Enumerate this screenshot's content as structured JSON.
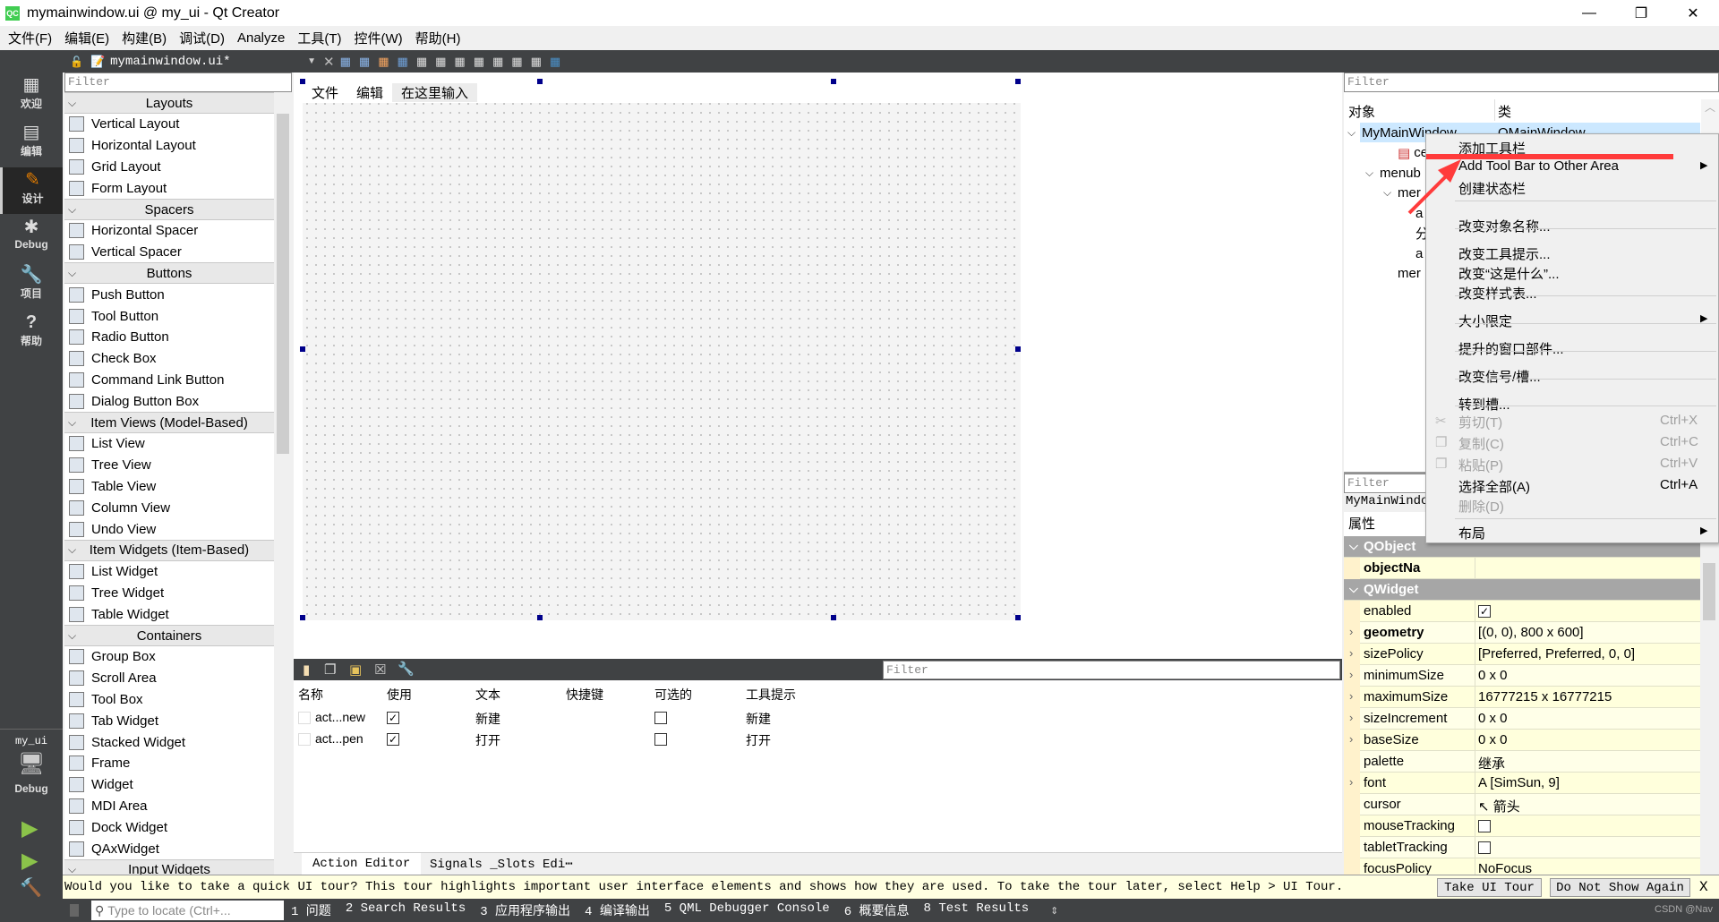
{
  "window": {
    "title": "mymainwindow.ui @ my_ui - Qt Creator",
    "logo": "QC"
  },
  "menubar": [
    "文件(F)",
    "编辑(E)",
    "构建(B)",
    "调试(D)",
    "Analyze",
    "工具(T)",
    "控件(W)",
    "帮助(H)"
  ],
  "toolbar": {
    "file": "mymainwindow.ui*",
    "close": "✕"
  },
  "modes": [
    {
      "label": "欢迎",
      "icon": "grid-icon",
      "glyph": "▦"
    },
    {
      "label": "编辑",
      "icon": "document-icon",
      "glyph": "▤"
    },
    {
      "label": "设计",
      "icon": "pencil-icon",
      "glyph": "✎"
    },
    {
      "label": "Debug",
      "icon": "bug-icon",
      "glyph": "✱"
    },
    {
      "label": "项目",
      "icon": "wrench-icon",
      "glyph": "🔧"
    },
    {
      "label": "帮助",
      "icon": "help-icon",
      "glyph": "?"
    }
  ],
  "kit": {
    "project": "my_ui",
    "mode": "Debug"
  },
  "widget_box": {
    "filter_placeholder": "Filter",
    "items": [
      {
        "h": "Layouts"
      },
      {
        "t": "Vertical Layout"
      },
      {
        "t": "Horizontal Layout"
      },
      {
        "t": "Grid Layout"
      },
      {
        "t": "Form Layout"
      },
      {
        "h": "Spacers"
      },
      {
        "t": "Horizontal Spacer"
      },
      {
        "t": "Vertical Spacer"
      },
      {
        "h": "Buttons"
      },
      {
        "t": "Push Button"
      },
      {
        "t": "Tool Button"
      },
      {
        "t": "Radio Button"
      },
      {
        "t": "Check Box"
      },
      {
        "t": "Command Link Button"
      },
      {
        "t": "Dialog Button Box"
      },
      {
        "h": "Item Views (Model-Based)"
      },
      {
        "t": "List View"
      },
      {
        "t": "Tree View"
      },
      {
        "t": "Table View"
      },
      {
        "t": "Column View"
      },
      {
        "t": "Undo View"
      },
      {
        "h": "Item Widgets (Item-Based)"
      },
      {
        "t": "List Widget"
      },
      {
        "t": "Tree Widget"
      },
      {
        "t": "Table Widget"
      },
      {
        "h": "Containers"
      },
      {
        "t": "Group Box"
      },
      {
        "t": "Scroll Area"
      },
      {
        "t": "Tool Box"
      },
      {
        "t": "Tab Widget"
      },
      {
        "t": "Stacked Widget"
      },
      {
        "t": "Frame"
      },
      {
        "t": "Widget"
      },
      {
        "t": "MDI Area"
      },
      {
        "t": "Dock Widget"
      },
      {
        "t": "QAxWidget"
      },
      {
        "h": "Input Widgets"
      }
    ]
  },
  "form": {
    "menus": [
      "文件",
      "编辑",
      "在这里输入"
    ]
  },
  "action_editor": {
    "filter_placeholder": "Filter",
    "columns": [
      "名称",
      "使用",
      "文本",
      "快捷键",
      "可选的",
      "工具提示"
    ],
    "rows": [
      {
        "name": "act...new",
        "used": true,
        "text": "新建",
        "shortcut": "",
        "checkable": false,
        "tooltip": "新建"
      },
      {
        "name": "act...pen",
        "used": true,
        "text": "打开",
        "shortcut": "",
        "checkable": false,
        "tooltip": "打开"
      }
    ],
    "tabs": [
      "Action Editor",
      "Signals _Slots Edi⋯"
    ]
  },
  "object_inspector": {
    "filter_placeholder": "Filter",
    "columns": [
      "对象",
      "类"
    ],
    "class_selected": "QMainWindow",
    "tree": [
      {
        "t": "MyMainWindow",
        "d": 0,
        "exp": true,
        "sel": true
      },
      {
        "t": "cen",
        "d": 2
      },
      {
        "t": "menub",
        "d": 1,
        "exp": true
      },
      {
        "t": "mer",
        "d": 2,
        "exp": true
      },
      {
        "t": "a",
        "d": 3
      },
      {
        "t": "分",
        "d": 3
      },
      {
        "t": "a",
        "d": 3
      },
      {
        "t": "mer",
        "d": 2
      }
    ]
  },
  "property_editor": {
    "filter_placeholder": "Filter",
    "object": "MyMainWindo",
    "header": "属性",
    "rows": [
      {
        "g": "QObject"
      },
      {
        "k": "objectNa",
        "bold": true,
        "v": ""
      },
      {
        "g": "QWidget"
      },
      {
        "k": "enabled",
        "cb": true
      },
      {
        "k": "geometry",
        "bold": true,
        "exp": true,
        "v": "[(0, 0), 800 x 600]"
      },
      {
        "k": "sizePolicy",
        "exp": true,
        "v": "[Preferred, Preferred, 0, 0]"
      },
      {
        "k": "minimumSize",
        "exp": true,
        "v": "0 x 0"
      },
      {
        "k": "maximumSize",
        "exp": true,
        "v": "16777215 x 16777215"
      },
      {
        "k": "sizeIncrement",
        "exp": true,
        "v": "0 x 0"
      },
      {
        "k": "baseSize",
        "exp": true,
        "v": "0 x 0"
      },
      {
        "k": "palette",
        "v": "继承"
      },
      {
        "k": "font",
        "exp": true,
        "v": "A  [SimSun, 9]"
      },
      {
        "k": "cursor",
        "v": "↖  箭头"
      },
      {
        "k": "mouseTracking",
        "cb": false
      },
      {
        "k": "tabletTracking",
        "cb": false
      },
      {
        "k": "focusPolicy",
        "v": "NoFocus"
      }
    ]
  },
  "context_menu": {
    "items": [
      {
        "l": "添加工具栏"
      },
      {
        "l": "Add Tool Bar to Other Area",
        "sub": true
      },
      {
        "l": "创建状态栏"
      },
      {
        "sep": true
      },
      {
        "l": "改变对象名称..."
      },
      {
        "sep": true
      },
      {
        "l": "改变工具提示..."
      },
      {
        "l": "改变“这是什么”..."
      },
      {
        "l": "改变样式表..."
      },
      {
        "sep": true
      },
      {
        "l": "大小限定",
        "sub": true
      },
      {
        "sep": true
      },
      {
        "l": "提升的窗口部件..."
      },
      {
        "sep": true
      },
      {
        "l": "改变信号/槽..."
      },
      {
        "sep": true
      },
      {
        "l": "转到槽..."
      },
      {
        "sep": true
      },
      {
        "l": "剪切(T)",
        "sc": "Ctrl+X",
        "dis": true,
        "icon": "scissors-icon"
      },
      {
        "l": "复制(C)",
        "sc": "Ctrl+C",
        "dis": true,
        "icon": "copy-icon"
      },
      {
        "l": "粘贴(P)",
        "sc": "Ctrl+V",
        "dis": true,
        "icon": "paste-icon"
      },
      {
        "l": "选择全部(A)",
        "sc": "Ctrl+A"
      },
      {
        "l": "删除(D)",
        "dis": true
      },
      {
        "sep": true
      },
      {
        "l": "布局",
        "sub": true
      }
    ]
  },
  "tour": {
    "message": "Would you like to take a quick UI tour? This tour highlights important user interface elements and shows how they are used. To take the tour later, select Help > UI Tour.",
    "take": "Take UI Tour",
    "dismiss": "Do Not Show Again",
    "close": "X"
  },
  "statusbar": {
    "locate_placeholder": "Type to locate (Ctrl+...",
    "panes": [
      "1 问题",
      "2 Search Results",
      "3 应用程序输出",
      "4 编译输出",
      "5 QML Debugger Console",
      "6 概要信息",
      "8 Test Results"
    ],
    "watermark": "CSDN @Nav"
  },
  "colors": {
    "dark": "#404244",
    "selection": "#cce8ff",
    "annotation": "#ff3b3b",
    "property_bg": "#ffffdc"
  }
}
